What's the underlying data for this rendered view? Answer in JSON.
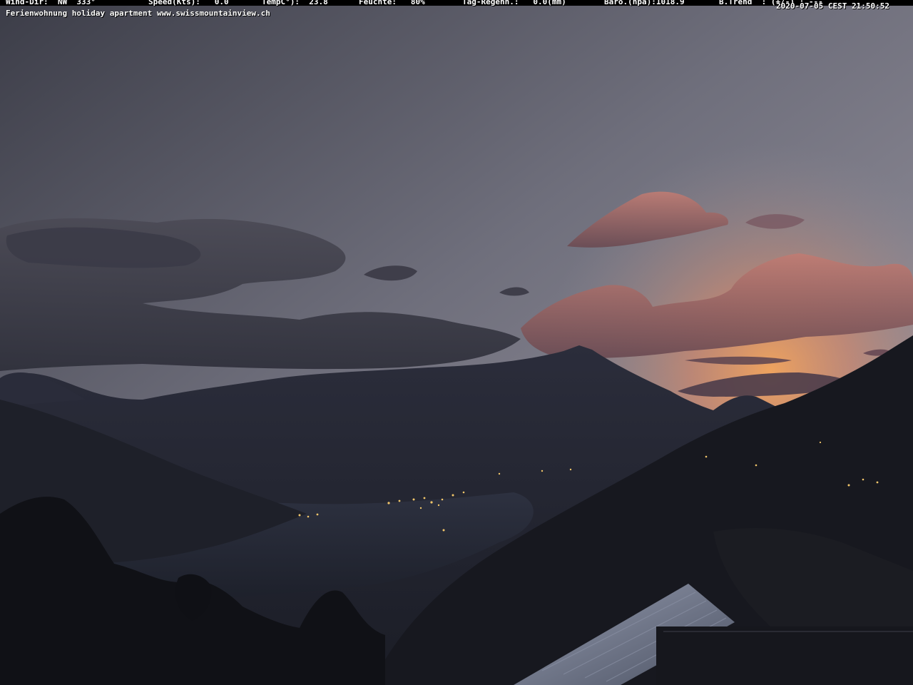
{
  "overlay": {
    "wind_dir": "Wind-Dir:  NW  333°",
    "speed": "Speed(Kts):   0.0",
    "temp": "TempC°):  23.8",
    "humidity": "Feuchte:   80%",
    "rain": "Tag-Regenn.:   0.0(mm)",
    "baro": "Baro.(hpa):1018.9",
    "trend": "B.Trend  : (+/-) : ---",
    "timestamp": "2020-07-05 CEST 21:50:52",
    "caption": "Ferienwohnung holiday apartment www.swissmountainview.ch"
  },
  "colors": {
    "sky_top": "#4a4b56",
    "sky_mid": "#7b7b88",
    "horizon_glow": "#e9a46a",
    "cloud_lit": "#b06b6a",
    "mountains": "#1f2230",
    "foreground": "#15161c",
    "lake": "#262a36",
    "lights": "#f2c66a"
  },
  "icons": [
    "sunset-scene"
  ]
}
